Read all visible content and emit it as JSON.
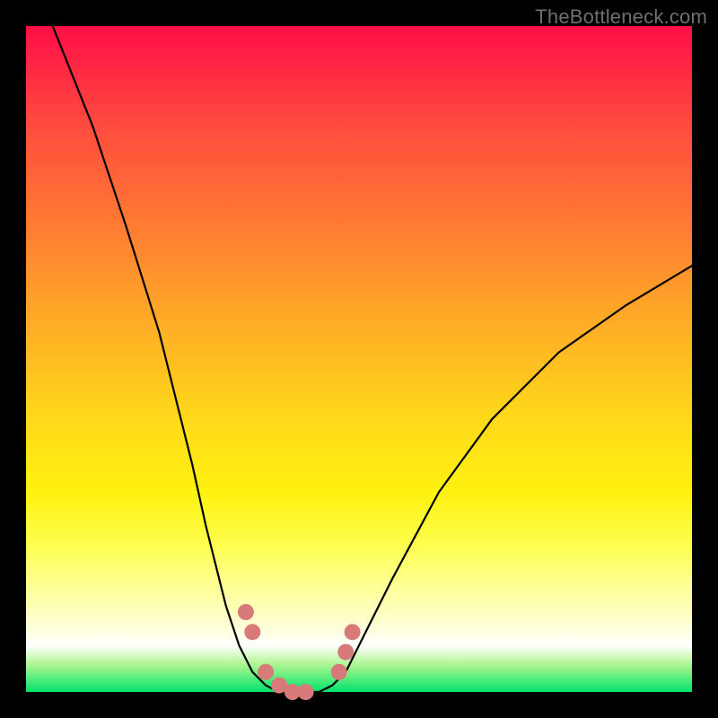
{
  "watermark": "TheBottleneck.com",
  "chart_data": {
    "type": "line",
    "title": "",
    "xlabel": "",
    "ylabel": "",
    "xlim": [
      0,
      100
    ],
    "ylim": [
      0,
      100
    ],
    "series": [
      {
        "name": "left-curve",
        "x": [
          4,
          10,
          15,
          20,
          25,
          27,
          30,
          32,
          34,
          36,
          38,
          40,
          42
        ],
        "y": [
          100,
          85,
          70,
          54,
          34,
          25,
          13,
          7,
          3,
          1,
          0,
          0,
          0
        ]
      },
      {
        "name": "right-curve",
        "x": [
          42,
          44,
          46,
          48,
          50,
          55,
          62,
          70,
          80,
          90,
          100
        ],
        "y": [
          0,
          0,
          1,
          3,
          7,
          17,
          30,
          41,
          51,
          58,
          64
        ]
      }
    ],
    "markers": {
      "name": "highlight-dots",
      "color": "#d97a7a",
      "points": [
        {
          "x": 33,
          "y": 12
        },
        {
          "x": 34,
          "y": 9
        },
        {
          "x": 36,
          "y": 3
        },
        {
          "x": 38,
          "y": 1
        },
        {
          "x": 40,
          "y": 0
        },
        {
          "x": 42,
          "y": 0
        },
        {
          "x": 47,
          "y": 3
        },
        {
          "x": 48,
          "y": 6
        },
        {
          "x": 49,
          "y": 9
        }
      ]
    },
    "gradient_stops": [
      {
        "pos": 0.0,
        "color": "#ff0e46"
      },
      {
        "pos": 0.3,
        "color": "#ff7b32"
      },
      {
        "pos": 0.6,
        "color": "#ffe516"
      },
      {
        "pos": 0.8,
        "color": "#feff7a"
      },
      {
        "pos": 0.93,
        "color": "#ffffff"
      },
      {
        "pos": 1.0,
        "color": "#00e36b"
      }
    ]
  }
}
